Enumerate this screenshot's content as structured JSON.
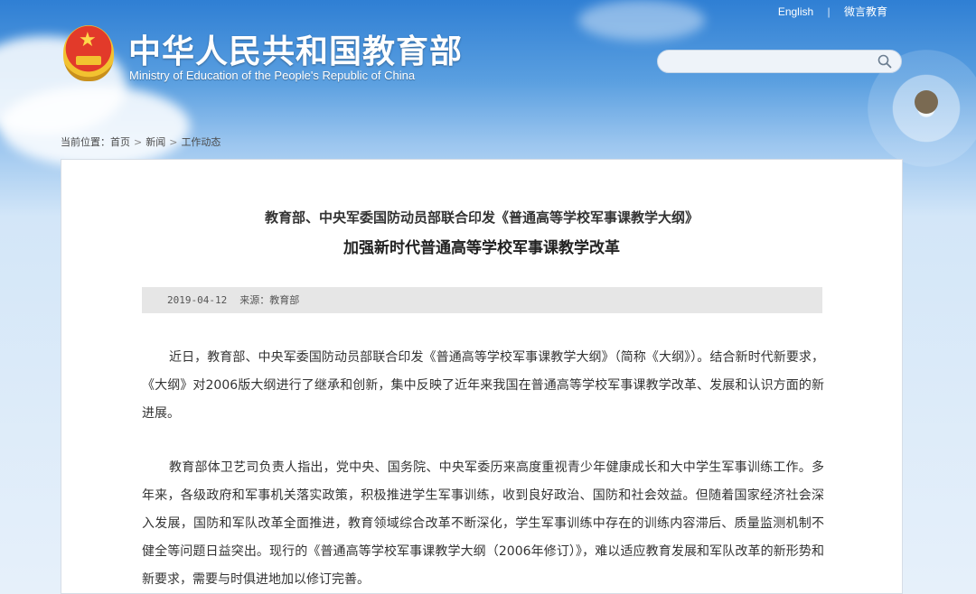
{
  "header": {
    "site_title": "中华人民共和国教育部",
    "site_subtitle": "Ministry of Education of the People's Republic of China",
    "links": {
      "english": "English",
      "weibo": "微言教育"
    },
    "search": {
      "placeholder": ""
    }
  },
  "breadcrumb": {
    "label": "当前位置：",
    "items": [
      "首页",
      "新闻",
      "工作动态"
    ]
  },
  "article": {
    "pre_title": "教育部、中央军委国防动员部联合印发《普通高等学校军事课教学大纲》",
    "title": "加强新时代普通高等学校军事课教学改革",
    "date": "2019-04-12",
    "source": "来源：教育部",
    "paragraphs": [
      "近日，教育部、中央军委国防动员部联合印发《普通高等学校军事课教学大纲》（简称《大纲》）。结合新时代新要求，《大纲》对2006版大纲进行了继承和创新，集中反映了近年来我国在普通高等学校军事课教学改革、发展和认识方面的新进展。",
      "教育部体卫艺司负责人指出，党中央、国务院、中央军委历来高度重视青少年健康成长和大中学生军事训练工作。多年来，各级政府和军事机关落实政策，积极推进学生军事训练，收到良好政治、国防和社会效益。但随着国家经济社会深入发展，国防和军队改革全面推进，教育领域综合改革不断深化，学生军事训练中存在的训练内容滞后、质量监测机制不健全等问题日益突出。现行的《普通高等学校军事课教学大纲（2006年修订）》，难以适应教育发展和军队改革的新形势和新要求，需要与时俱进地加以修订完善。"
    ]
  },
  "colors": {
    "sky_top": "#2f7fd4",
    "sky_bottom": "#e6f0fa",
    "meta_bar": "#e6e6e6",
    "emblem_red": "#e23a2a",
    "emblem_gold": "#f2c230"
  },
  "icons": [
    "national-emblem-icon",
    "search-icon",
    "breadcrumb-arrow-icon"
  ]
}
